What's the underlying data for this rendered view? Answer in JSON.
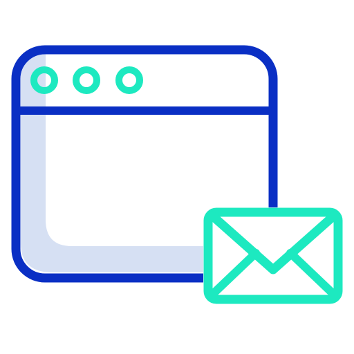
{
  "icon": {
    "browser_window_icon": "browser-window-icon",
    "window_dots_icon": "window-control-dots-icon",
    "email_envelope_icon": "email-envelope-icon",
    "colors": {
      "window_outline": "#0a2fc4",
      "window_shadow": "#d6e0f3",
      "accent": "#1de9c0",
      "background": "#ffffff"
    }
  }
}
